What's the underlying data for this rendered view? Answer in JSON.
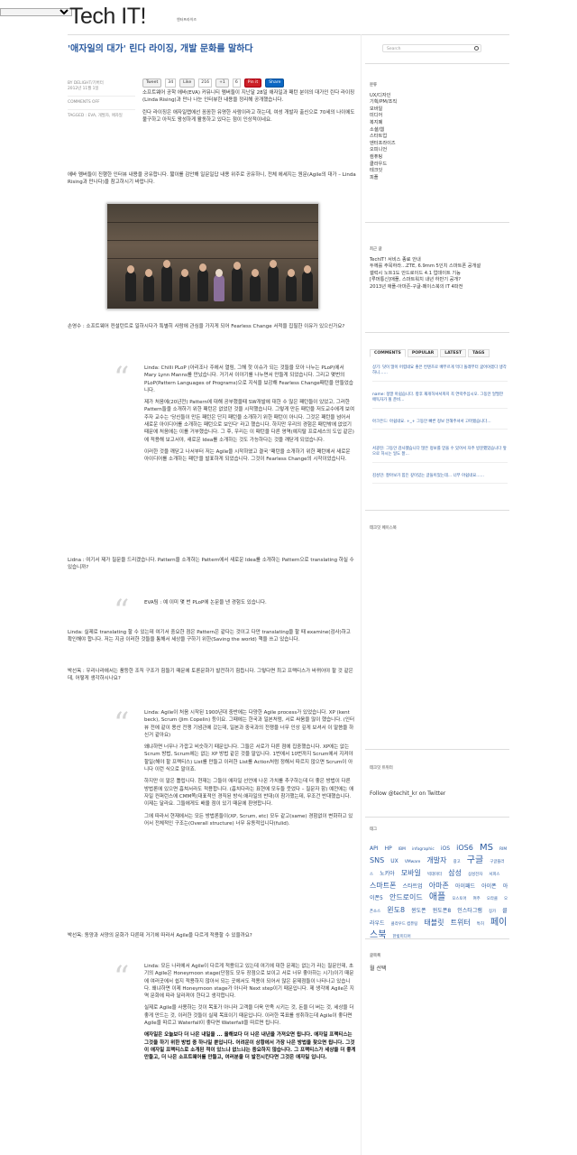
{
  "topbar": {
    "select": ""
  },
  "site": {
    "title": "Tech IT!",
    "subtitle": "엔터프라이즈"
  },
  "post": {
    "title": "'애자일의 대가' 린다 라이징, 개발 문화를 말하다",
    "author": "BY DELIGHT/기버터",
    "date": "2012년 11월 1일",
    "comments": "COMMENTS OFF",
    "tagged": "TAGGED : EVA, 개발자, 애자일",
    "share": {
      "tweet": "Tweet",
      "tweet_count": "34",
      "like": "Like",
      "like_count": "216",
      "gplus": "+1",
      "gplus_count": "6",
      "pin": "Pin it",
      "share": "Share"
    },
    "intro1": "소프트웨어 공학 에바(EVA) 커뮤니티 멤버들이 지난달 28일 애자일과 패턴 분야의 대가인 린다 라이징(Linda Rising)과 만나 나눈 인터뷰한 내용을 정리해 공개했습니다.",
    "intro2": "린다 라이징은 애자일랩에선 꼼꼼한 유명한 사람이라고 하는데, 여성 개발자 출신으로 70세의 나이에도 불구하고 아직도 왕성하게 활동하고 있다는 점이 인상적이네요.",
    "intro3": "에바 멤버들이 진행한 인터뷰 내용을 공유합니다. 짧이를 감안해 일문일답 내용 위주로 공유하니, 전체 에세지는 원문(Agile의 대가 – Linda Rising과 만나다)을 참고하시기 바랍니다.",
    "q1": "손영수 : 소프트웨어 컨설턴트로 일하시다가 특별히 사람에 관심을 가지게 되어 Fearless Change 서적을 집필한 이유가 있으신가요?",
    "a1_1": "Linda: Chilli PLoP (아리조나 주에서 열림, 그해 핫 이슈가 되는 것들을 모아 나누는 PLoP)에서 Mary Lynn Manns를 만났습니다. 거기서 이야기를 나누면서 만들게 되었습니다. 그리고 몇번의 PLoP(Pattern Languages of Programs)으로 지식을 보강해 Fearless Change패턴을 만들었습니다.",
    "a1_2": "제가 처음에(20년전) Pattern에 대해 공부했을때 SW개발에 대한 수 많은 패턴들이 있었고, 그러한 Pattern들을 소개하기 위한 패턴은 없었던 것을 시작했습니다. 그렇게 만든 패턴을 저도교수에게 보여주자 교수는 '당신들이 만든 패턴은 단지 패턴을 소개하기 위한 패턴이 아니다. 그것은 패턴을 넘어서 새로운 아이디어를 소개하는 패턴으로 보인다' 라고 했습니다. 하지만 우리의 경험은 패턴밖에 없었기 때문에 처음에는 이를 거부했습니다. 그 후, 우리는 이 패턴을 다른 영역(예지탈 프로세스의 도입 같은)에 적용해 보고서야, 새로운 Idea를 소개하는 것도 가능하다는 것을 깨닫게 되었습니다.",
    "a1_3": "이러한 것을 깨닫고 나서부터 저는 Agile을 시작하였고 결국 '패턴을 소개하기 위한 패턴에서 새로운 아이디어를 소개하는 패턴'을 발표하게 되었습니다. 그것이 Fearless Change의 시작이었습니다.",
    "q2": "Lidna : 여기서 제가 질문을 드리겠습니다. Pattern을 소개하는 Pattern에서 새로운 Idea를 소개하는 Pattern으로 translating 하실 수 있습니까?",
    "a2": "EVA팀 : 예 이미 몇 번 PLoP에 논문을 낸 경험도 있습니다.",
    "q3": "Linda: 실제로 translating 할 수 있는데 여기서 중요한 점은 Pattern은 같다는 것이고 다만 translating을 할 때 examine(검사)하고 확인해야 합니다. 저는 지금 이러한 것들을 통해서 세상을 구하기 위한(Saving the world) 책을 쓰고 있습니다.",
    "q4": "박선옥 : 우리나라에서는 풍등한 조직 구조가 힘들기 때문에 토론문화가 발전하기 힘듭니다. 그렇다면 최고 프랙티스가 바뀌어야 할 것 같은데, 어떻게 생각하시나요?",
    "a4_1": "Linda: Agile이 처음 시작된 1900년대 중반에는 다양한 Agile process가 있었습니다. XP (kent beck), Scrum (Jim Copelin) 등이요. 그때에는 한국과 일본처럼, 서로 싸움을 많이 했습니다. (인터뷰 전에 같이 용산 전쟁 기념관에 갔는데, 일본과 중국과의 전쟁을 너무 인상 깊게 보셔서 이 말씀을 하신거 같아요)",
    "a4_2": "왜냐하면 너무나 가깝고 비슷하기 때문입니다. 그들은 서로가 다른 점에 집중했습니다. XP에는 없는 Scrum 방법, Scrum에는 없는 XP 방법 같은 것을 말입니다. 1번에서 10번까지 Scrum에서 지켜야 할일(해야 할 프랙티스) List를 만들고 이러한 List를 Action처럼 정해서 따르지 않으면 Scrum이 아니다 이런 식으로 말이죠.",
    "a4_3": "하지만 이 말은 틀립니다. 현재는 그들이 애자일 선언에 나온 가치를 추구하는데 더 좋은 방법이 다른 방법론에 있으면 흡쳐서라도 적용합니다. (흡치다라는 표현에 모두들 웃었다 – 질문자 함) 예전에는 애자일 컨퍼런스에 CMM쪽(대표적인 경직된 방식:애자일의 반대)이 참가했는데, 무조건 반대했습니다. 이제는 달라요. 그들에게도 배울 점이 있기 때문에 환영합니다.",
    "a4_4": "그에 따라서 현재에서는 모든 방법론들이(XP, Scrum, etc) 모두 같고(same) 경험없이 변화하고 있어서 전체적인 구조는(Overall structure) 너무 유동적입니다(fulid).",
    "q5": "박선옥: 동양과 서양의 문화가 다른데 거기에 따라서 Agile을 다르게 적용할 수 있을까요?",
    "a5_1": "Linda: 모든 나라에서 Agile이 다르게 적용되고 있는데 여기에 대한 문제는 없는가 라는 질문인데, 초기의 Agile은 Honeymoon stage(단점도 모두 장점으로 보이고 서로 너무 좋아하는 시기)이기 때문에 여러곳에서 쉽지 적용하지 않아서 되는 곳에서도 적용이 되어서 많은 문제점들이 나타나고 있습니다. 왜냐하면 이제 Honeymoon stage가 아니라 Next step이기 때문입니다. 제 생각에 Agile은 지역 문화에 따라 달라져야 한다고 생각합니다.",
    "a5_2": "실제로 Agile을 사용하는 것이 목표가 아니라 고객을 더욱 만족 시키는 것, 돈을 더 버는 것, 세상을 더 좋게 만드는 것, 이러한 것들이 실제 목표이기 때문입니다. 이러한 목표를 성취하는데 Agile이 좋다면 Agile을 따르고 Waterfall이 좋다면 Waterfall을 따르면 됩니다.",
    "a5_3": "애자일은 오늘보다 더 나은 내일을 ... 올해보다 더 나은 내년을 가져오면 됩니다. 애자일 프랙티스는 그것을 하기 위한 방법 중 하나일 뿐입니다. 어려운이 상황에서 가장 나은 방법을 찾으면 됩니다. 그것이 애자일 프랙티스로 소개된 적이 있느냐 없느냐는 중요하지 않습니다. 그 프랙티스가 세상을 더 좋게 만들고, 더 나은 소프트웨어를 만들고, 여러분을 더 발전시킨다면 그것은 애자일 입니다."
  },
  "sidebar": {
    "search_placeholder": "Search",
    "categories_head": "분류",
    "categories": [
      "UX/디자인",
      "기획/PM/조직",
      "모바일",
      "미디어",
      "복지폐",
      "소셜/웹",
      "스타트업",
      "엔터프라이즈",
      "오피니언",
      "컴퓨팅",
      "클라우드",
      "테크잇",
      "피플"
    ],
    "recent_head": "최근 글",
    "recent": [
      "TechIT! 서비스 종료 안내",
      "두께를 주목하라…ZTE, 6.9mm 5인치 스마트폰 공개설",
      "갤럭시 노트1도 안드로이드 4.1 업데이트 기능",
      "[루머통신]애플, 스마트워치 내년 하반기 공개?",
      "2013년 애플-아마존-구글-페이스북의 IT 4파전"
    ],
    "tabs": [
      "COMMENTS",
      "POPULAR",
      "LATEST",
      "TAGS"
    ],
    "comments": [
      "상기: 덧이 많이 어렵네요 좋은 컨텐츠로 배부르게 먹다 돌래부터 굶어야겠다 생각하니……",
      "name: 정말 아쉽습니다. 항후 재개하셔서까지 꼭 연락주십시오. 그동안 얼떨한 애독자가 될 준비…",
      "아크은드: 아쉽네요. +_+ 그동안 빠른 정보 전해주셔서 고마웠습니다…",
      "서광진: 그동안 감사했습니다 많은 정보를 얻을 수 있어서 자주 방문했었습니다 앞으로 하시는 일도 잘…",
      "김성민: 잘아보가 힘든 깊이있는 글들이었는데… 너무 아쉽네요……"
    ],
    "facebook_head": "테크잇 페이스북",
    "twitter_head": "테크잇 트위터",
    "twitter_follow": "Follow @techit_kr on Twitter",
    "tags_head": "태그",
    "tags": [
      [
        "API",
        1
      ],
      [
        "HP",
        1
      ],
      [
        "IBM",
        0
      ],
      [
        "infographic",
        0
      ],
      [
        "iOS",
        1
      ],
      [
        "iOS6",
        2
      ],
      [
        "MS",
        3
      ],
      [
        "RIM",
        0
      ],
      [
        "SNS",
        2
      ],
      [
        "UX",
        1
      ],
      [
        "VMware",
        0
      ],
      [
        "개발자",
        2
      ],
      [
        "광고",
        0
      ],
      [
        "구글",
        3
      ],
      [
        "구글플러스",
        0
      ],
      [
        "노키아",
        1
      ],
      [
        "모바일",
        2
      ],
      [
        "빅데이터",
        0
      ],
      [
        "삼성",
        2
      ],
      [
        "삼성전자",
        0
      ],
      [
        "서피스",
        0
      ],
      [
        "스마트폰",
        2
      ],
      [
        "스타트업",
        1
      ],
      [
        "아마존",
        2
      ],
      [
        "아이패드",
        1
      ],
      [
        "아이폰",
        1
      ],
      [
        "아이폰5",
        1
      ],
      [
        "안드로이드",
        2
      ],
      [
        "애플",
        3
      ],
      [
        "오스토어",
        0
      ],
      [
        "여주",
        0
      ],
      [
        "오라클",
        0
      ],
      [
        "오픈소스",
        0
      ],
      [
        "윈도8",
        2
      ],
      [
        "윈도폰",
        1
      ],
      [
        "윈도폰8",
        1
      ],
      [
        "인스타그램",
        1
      ],
      [
        "징가",
        0
      ],
      [
        "클라우드",
        1
      ],
      [
        "클라우드 컴퓨팅",
        0
      ],
      [
        "태블릿",
        2
      ],
      [
        "트위터",
        2
      ],
      [
        "특허",
        0
      ],
      [
        "페이스북",
        3
      ],
      [
        "한빛미디어",
        0
      ]
    ],
    "archive_head": "글목록",
    "archive_select": "월 선택"
  },
  "colors": {
    "link": "#2a5aa0",
    "quote_mark": "#d4d4d4"
  }
}
